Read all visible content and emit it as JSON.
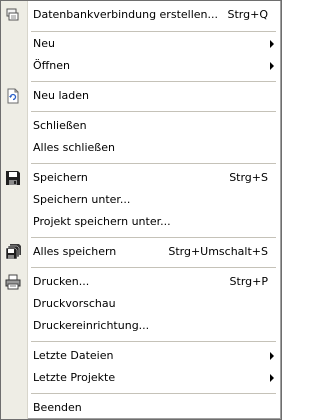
{
  "menu": {
    "items": [
      {
        "label": "Datenbankverbindung erstellen...",
        "shortcut": "Strg+Q",
        "icon": "database-connection-icon"
      },
      {
        "label": "Neu",
        "submenu": true
      },
      {
        "label": "Öffnen",
        "submenu": true
      },
      {
        "label": "Neu laden",
        "icon": "reload-icon"
      },
      {
        "label": "Schließen"
      },
      {
        "label": "Alles schließen"
      },
      {
        "label": "Speichern",
        "shortcut": "Strg+S",
        "icon": "floppy-disk-icon"
      },
      {
        "label": "Speichern unter..."
      },
      {
        "label": "Projekt speichern unter..."
      },
      {
        "label": "Alles speichern",
        "shortcut": "Strg+Umschalt+S",
        "icon": "save-all-icon"
      },
      {
        "label": "Drucken...",
        "shortcut": "Strg+P",
        "icon": "printer-icon"
      },
      {
        "label": "Druckvorschau"
      },
      {
        "label": "Druckereinrichtung..."
      },
      {
        "label": "Letzte Dateien",
        "submenu": true
      },
      {
        "label": "Letzte Projekte",
        "submenu": true
      },
      {
        "label": "Beenden"
      }
    ]
  }
}
